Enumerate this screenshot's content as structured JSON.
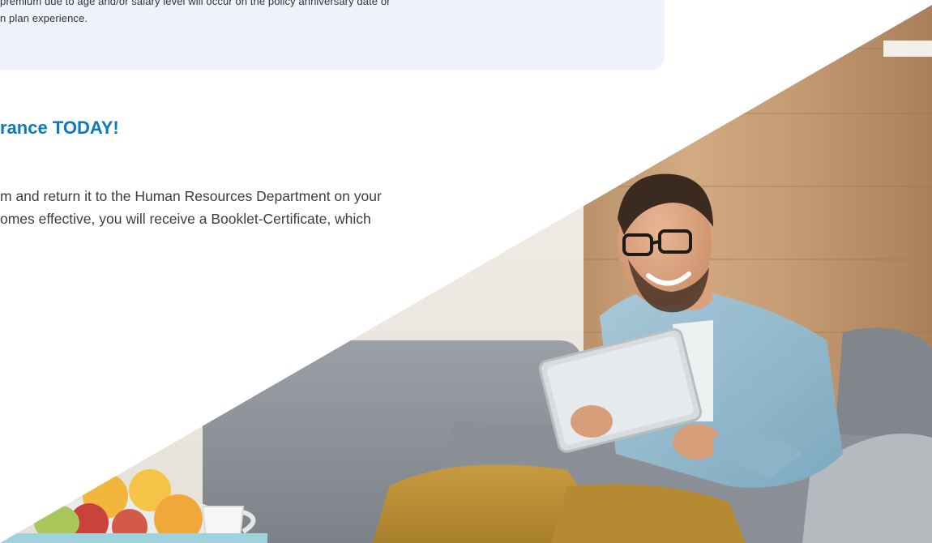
{
  "info_box": {
    "line1": "premium due to age and/or salary level will occur on the policy anniversary date or",
    "line2": "n plan experience."
  },
  "headline": "rance TODAY!",
  "body": {
    "line1": "m and return it to the Human Resources Department on your",
    "line2": "omes effective, you will receive a Booklet-Certificate, which"
  },
  "colors": {
    "accent": "#0b7bbd",
    "info_box_bg": "#eef2fb",
    "text": "#3d3d3d"
  }
}
